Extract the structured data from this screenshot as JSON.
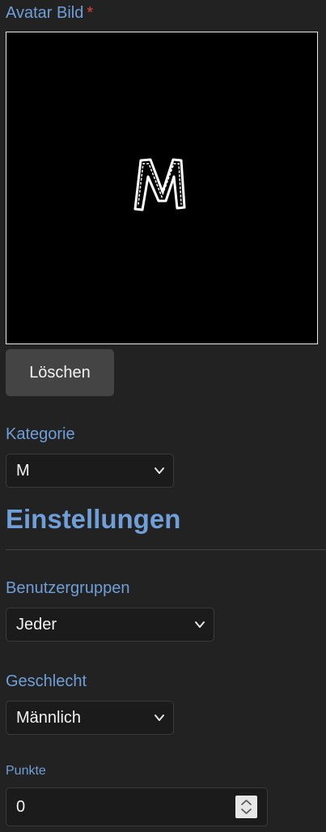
{
  "avatar": {
    "label": "Avatar Bild",
    "required_marker": "*",
    "image_letter": "M",
    "delete_label": "Löschen"
  },
  "kategorie": {
    "label": "Kategorie",
    "value": "M"
  },
  "settings": {
    "heading": "Einstellungen"
  },
  "benutzergruppen": {
    "label": "Benutzergruppen",
    "value": "Jeder"
  },
  "geschlecht": {
    "label": "Geschlecht",
    "value": "Männlich"
  },
  "punkte": {
    "label": "Punkte",
    "value": "0"
  },
  "colors": {
    "background": "#222222",
    "label": "#6f9fd8",
    "required": "#e0453a",
    "button": "#444444",
    "input_bg": "#1b1b1b"
  },
  "icons": {
    "select_arrow": "chevron-down-icon",
    "number_spinner": "spinner-icon"
  }
}
